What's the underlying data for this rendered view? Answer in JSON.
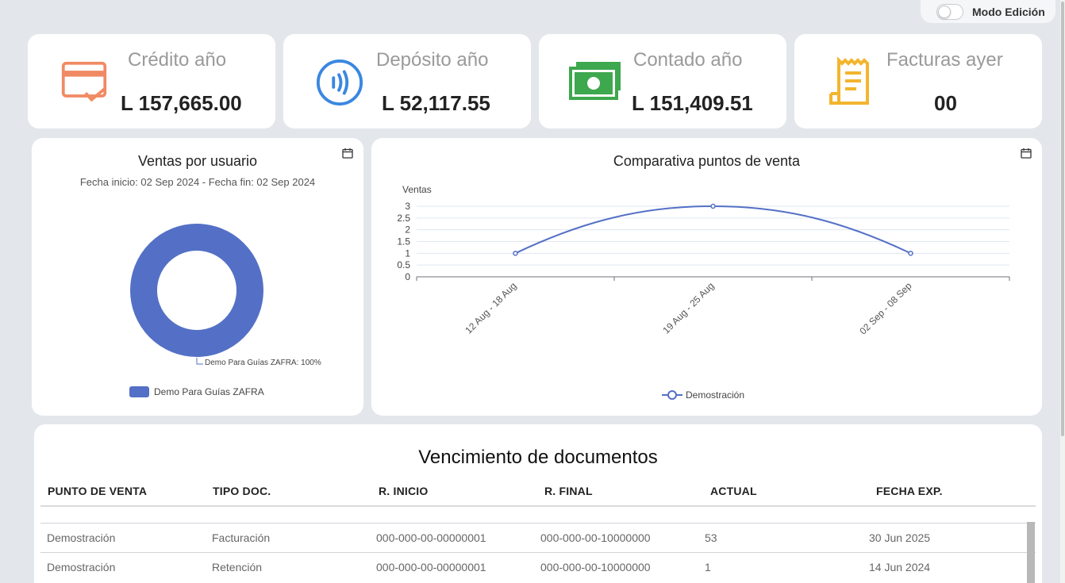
{
  "toggle": {
    "label": "Modo Edición"
  },
  "kpis": [
    {
      "title": "Crédito año",
      "value": "L 157,665.00",
      "icon": "credit-card-icon",
      "color": "#f08a63"
    },
    {
      "title": "Depósito año",
      "value": "L 52,117.55",
      "icon": "contactless-icon",
      "color": "#3a87e0"
    },
    {
      "title": "Contado año",
      "value": "L 151,409.51",
      "icon": "cash-icon",
      "color": "#3da84d"
    },
    {
      "title": "Facturas ayer",
      "value": "00",
      "icon": "receipt-icon",
      "color": "#f3b52e"
    }
  ],
  "donut_card": {
    "title": "Ventas por usuario",
    "subtitle": "Fecha inicio: 02 Sep 2024 - Fecha fin: 02 Sep 2024",
    "slice_label": "Demo Para Guías ZAFRA: 100%",
    "legend": "Demo Para Guías ZAFRA"
  },
  "line_card": {
    "title": "Comparativa puntos de venta",
    "legend": "Demostración"
  },
  "chart_data": [
    {
      "type": "pie",
      "title": "Ventas por usuario",
      "labels": [
        "Demo Para Guías ZAFRA"
      ],
      "values": [
        100
      ],
      "color": "#5470c6"
    },
    {
      "type": "line",
      "title": "Comparativa puntos de venta",
      "ylabel": "Ventas",
      "categories": [
        "12 Aug - 18 Aug",
        "19 Aug - 25 Aug",
        "02 Sep - 08 Sep"
      ],
      "series": [
        {
          "name": "Demostración",
          "values": [
            1,
            3,
            1
          ]
        }
      ],
      "yticks": [
        "0",
        "0.5",
        "1",
        "1.5",
        "2",
        "2.5",
        "3"
      ],
      "ylim": [
        0,
        3
      ],
      "color": "#5470c6",
      "grid": true,
      "legend": "bottom"
    }
  ],
  "table": {
    "title": "Vencimiento de documentos",
    "headers": [
      "PUNTO DE VENTA",
      "TIPO DOC.",
      "R. INICIO",
      "R. FINAL",
      "ACTUAL",
      "FECHA EXP."
    ],
    "rows": [
      [
        "Demostración",
        "Facturación",
        "000-000-00-00000001",
        "000-000-00-10000000",
        "53",
        "30 Jun 2025"
      ],
      [
        "Demostración",
        "Retención",
        "000-000-00-00000001",
        "000-000-00-10000000",
        "1",
        "14 Jun 2024"
      ]
    ]
  }
}
